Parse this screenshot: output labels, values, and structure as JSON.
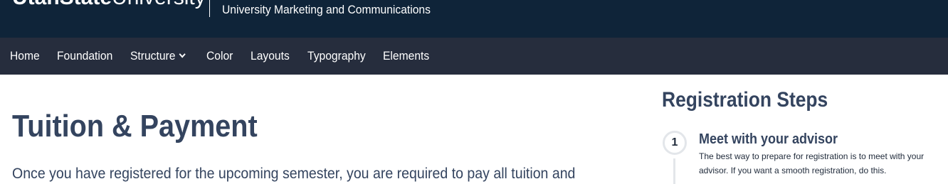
{
  "header": {
    "logo_bold": "UtahState",
    "logo_light": "University",
    "department": "University Marketing and Communications"
  },
  "nav": {
    "items": [
      {
        "label": "Home"
      },
      {
        "label": "Foundation"
      },
      {
        "label": "Structure",
        "icon": "chevron-down-icon"
      },
      {
        "label": "Color"
      },
      {
        "label": "Layouts"
      },
      {
        "label": "Typography"
      },
      {
        "label": "Elements"
      }
    ]
  },
  "main": {
    "title": "Tuition & Payment",
    "intro": "Once you have registered for the upcoming semester, you are required to pay all tuition and"
  },
  "sidebar": {
    "title": "Registration Steps",
    "steps": [
      {
        "number": "1",
        "title": "Meet with your advisor",
        "description": "The best way to prepare for registration is to meet with your advisor. If you want a smooth registration, do this."
      }
    ]
  },
  "colors": {
    "top_bar": "#0f2439",
    "nav_bar": "#262d3d",
    "heading": "#34445f",
    "step_ring": "#e3e6ea"
  }
}
